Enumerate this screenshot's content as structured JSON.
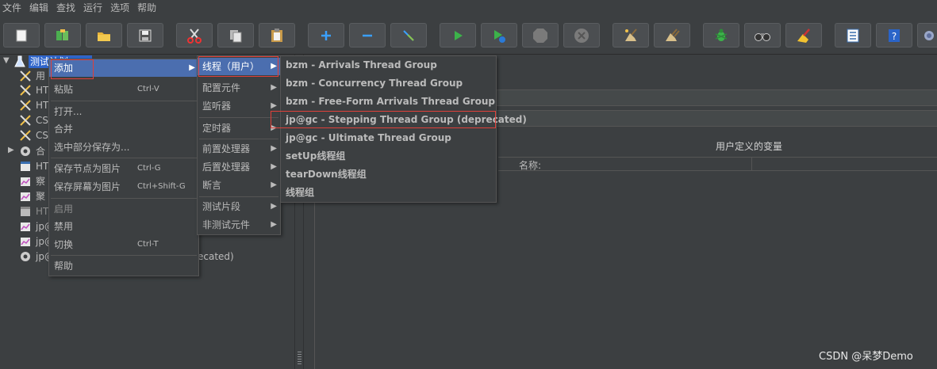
{
  "menubar": [
    "文件",
    "编辑",
    "查找",
    "运行",
    "选项",
    "帮助"
  ],
  "toolbar": {
    "icons": [
      "new-icon",
      "templates-icon",
      "open-icon",
      "save-icon",
      "cut-icon",
      "copy-icon",
      "paste-icon",
      "expand-icon",
      "collapse-icon",
      "toggle-icon",
      "start-icon",
      "start-no-pause-icon",
      "stop-icon",
      "shutdown-icon",
      "clear-icon",
      "clear-all-icon",
      "search-icon",
      "binoculars-icon",
      "reset-search-icon",
      "function-helper-icon",
      "help-icon",
      "remote-icon"
    ]
  },
  "tree": {
    "root_label": "测试计划",
    "children": [
      "用",
      "HT",
      "HT",
      "CS",
      "CS",
      "合",
      "HT",
      "察",
      "聚",
      "HT",
      "jp@",
      "jp@",
      "jp@"
    ],
    "behind_text": "ecated)"
  },
  "right_panel": {
    "table_title": "用户定义的变量",
    "column_name": "名称:"
  },
  "context_menu": {
    "items": [
      {
        "label": "添加",
        "accel": "",
        "submenu": true,
        "selected": true
      },
      {
        "label": "粘贴",
        "accel": "Ctrl-V"
      },
      {
        "label": "打开...",
        "accel": ""
      },
      {
        "label": "合并",
        "accel": ""
      },
      {
        "label": "选中部分保存为...",
        "accel": ""
      },
      {
        "label": "保存节点为图片",
        "accel": "Ctrl-G"
      },
      {
        "label": "保存屏幕为图片",
        "accel": "Ctrl+Shift-G"
      },
      {
        "label": "启用",
        "accel": "",
        "disabled": true
      },
      {
        "label": "禁用",
        "accel": ""
      },
      {
        "label": "切换",
        "accel": "Ctrl-T"
      },
      {
        "label": "帮助",
        "accel": ""
      }
    ]
  },
  "add_submenu": {
    "items": [
      "线程（用户）",
      "配置元件",
      "监听器",
      "定时器",
      "前置处理器",
      "后置处理器",
      "断言",
      "测试片段",
      "非测试元件"
    ]
  },
  "thread_submenu": {
    "items": [
      "bzm - Arrivals Thread Group",
      "bzm - Concurrency Thread Group",
      "bzm - Free-Form Arrivals Thread Group",
      "jp@gc - Stepping Thread Group (deprecated)",
      "jp@gc - Ultimate Thread Group",
      "setUp线程组",
      "tearDown线程组",
      "线程组"
    ]
  },
  "watermark": "CSDN @呆梦Demo",
  "colors": {
    "selection": "#4b6eaf",
    "highlight_box": "#e0403a",
    "background": "#3c3f41"
  }
}
